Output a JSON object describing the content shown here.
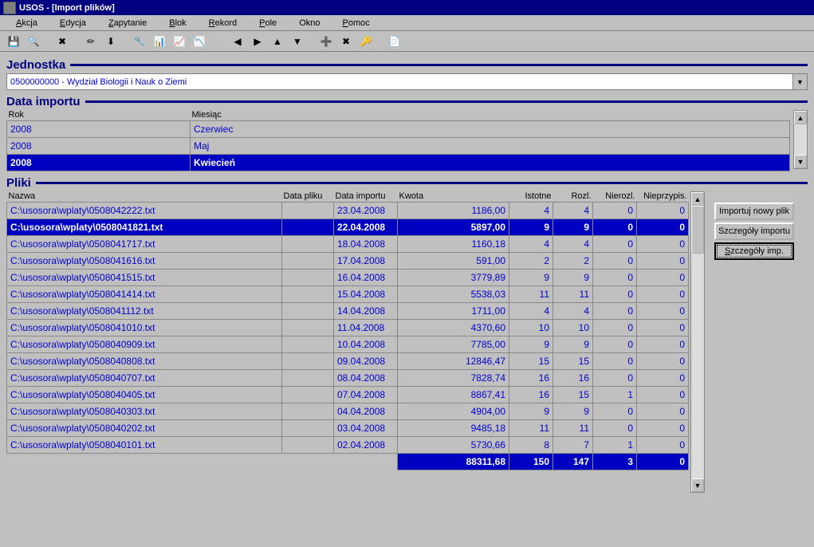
{
  "window": {
    "title": "USOS - [Import plików]"
  },
  "menu": {
    "items": [
      {
        "label": "Akcja",
        "u": 0
      },
      {
        "label": "Edycja",
        "u": 0
      },
      {
        "label": "Zapytanie",
        "u": 0
      },
      {
        "label": "Blok",
        "u": 0
      },
      {
        "label": "Rekord",
        "u": 0
      },
      {
        "label": "Pole",
        "u": 0
      },
      {
        "label": "Okno",
        "u": -1
      },
      {
        "label": "Pomoc",
        "u": 0
      }
    ]
  },
  "toolbar_icons": [
    "💾",
    "🔍",
    "✖",
    "✏",
    "⬇",
    "🔧",
    "📊",
    "📈",
    "📉",
    "◀",
    "▶",
    "▲",
    "▼",
    "➕",
    "✖",
    "🔑",
    "📄"
  ],
  "sections": {
    "jednostka": "Jednostka",
    "data_importu": "Data importu",
    "pliki": "Pliki"
  },
  "jednostka": {
    "value": "0500000000 - Wydział Biologii i Nauk o Ziemi"
  },
  "date_headers": {
    "rok": "Rok",
    "miesiac": "Miesiąc"
  },
  "dates": [
    {
      "rok": "2008",
      "miesiac": "Czerwiec",
      "sel": false
    },
    {
      "rok": "2008",
      "miesiac": "Maj",
      "sel": false
    },
    {
      "rok": "2008",
      "miesiac": "Kwiecień",
      "sel": true
    }
  ],
  "pliki_headers": {
    "nazwa": "Nazwa",
    "data_pliku": "Data pliku",
    "data_importu": "Data importu",
    "kwota": "Kwota",
    "istotne": "Istotne",
    "rozl": "Rozl.",
    "nierozl": "Nierozl.",
    "nieprzypis": "Nieprzypis."
  },
  "pliki": [
    {
      "nazwa": "C:\\usosora\\wplaty\\0508042222.txt",
      "dp": "",
      "di": "23.04.2008",
      "kw": "1186,00",
      "ist": "4",
      "roz": "4",
      "nr": "0",
      "np": "0",
      "sel": false
    },
    {
      "nazwa": "C:\\usosora\\wplaty\\0508041821.txt",
      "dp": "",
      "di": "22.04.2008",
      "kw": "5897,00",
      "ist": "9",
      "roz": "9",
      "nr": "0",
      "np": "0",
      "sel": true
    },
    {
      "nazwa": "C:\\usosora\\wplaty\\0508041717.txt",
      "dp": "",
      "di": "18.04.2008",
      "kw": "1160,18",
      "ist": "4",
      "roz": "4",
      "nr": "0",
      "np": "0",
      "sel": false
    },
    {
      "nazwa": "C:\\usosora\\wplaty\\0508041616.txt",
      "dp": "",
      "di": "17.04.2008",
      "kw": "591,00",
      "ist": "2",
      "roz": "2",
      "nr": "0",
      "np": "0",
      "sel": false
    },
    {
      "nazwa": "C:\\usosora\\wplaty\\0508041515.txt",
      "dp": "",
      "di": "16.04.2008",
      "kw": "3779,89",
      "ist": "9",
      "roz": "9",
      "nr": "0",
      "np": "0",
      "sel": false
    },
    {
      "nazwa": "C:\\usosora\\wplaty\\0508041414.txt",
      "dp": "",
      "di": "15.04.2008",
      "kw": "5538,03",
      "ist": "11",
      "roz": "11",
      "nr": "0",
      "np": "0",
      "sel": false
    },
    {
      "nazwa": "C:\\usosora\\wplaty\\0508041112.txt",
      "dp": "",
      "di": "14.04.2008",
      "kw": "1711,00",
      "ist": "4",
      "roz": "4",
      "nr": "0",
      "np": "0",
      "sel": false
    },
    {
      "nazwa": "C:\\usosora\\wplaty\\0508041010.txt",
      "dp": "",
      "di": "11.04.2008",
      "kw": "4370,60",
      "ist": "10",
      "roz": "10",
      "nr": "0",
      "np": "0",
      "sel": false
    },
    {
      "nazwa": "C:\\usosora\\wplaty\\0508040909.txt",
      "dp": "",
      "di": "10.04.2008",
      "kw": "7785,00",
      "ist": "9",
      "roz": "9",
      "nr": "0",
      "np": "0",
      "sel": false
    },
    {
      "nazwa": "C:\\usosora\\wplaty\\0508040808.txt",
      "dp": "",
      "di": "09.04.2008",
      "kw": "12846,47",
      "ist": "15",
      "roz": "15",
      "nr": "0",
      "np": "0",
      "sel": false
    },
    {
      "nazwa": "C:\\usosora\\wplaty\\0508040707.txt",
      "dp": "",
      "di": "08.04.2008",
      "kw": "7828,74",
      "ist": "16",
      "roz": "16",
      "nr": "0",
      "np": "0",
      "sel": false
    },
    {
      "nazwa": "C:\\usosora\\wplaty\\0508040405.txt",
      "dp": "",
      "di": "07.04.2008",
      "kw": "8867,41",
      "ist": "16",
      "roz": "15",
      "nr": "1",
      "np": "0",
      "sel": false
    },
    {
      "nazwa": "C:\\usosora\\wplaty\\0508040303.txt",
      "dp": "",
      "di": "04.04.2008",
      "kw": "4904,00",
      "ist": "9",
      "roz": "9",
      "nr": "0",
      "np": "0",
      "sel": false
    },
    {
      "nazwa": "C:\\usosora\\wplaty\\0508040202.txt",
      "dp": "",
      "di": "03.04.2008",
      "kw": "9485,18",
      "ist": "11",
      "roz": "11",
      "nr": "0",
      "np": "0",
      "sel": false
    },
    {
      "nazwa": "C:\\usosora\\wplaty\\0508040101.txt",
      "dp": "",
      "di": "02.04.2008",
      "kw": "5730,66",
      "ist": "8",
      "roz": "7",
      "nr": "1",
      "np": "0",
      "sel": false
    }
  ],
  "totals": {
    "kw": "88311,68",
    "ist": "150",
    "roz": "147",
    "nr": "3",
    "np": "0"
  },
  "buttons": {
    "import": "Importuj nowy plik",
    "details": "Szczegóły importu",
    "details2": "Szczegóły imp."
  },
  "col_widths": {
    "nazwa": 345,
    "dp": 65,
    "di": 80,
    "kw": 140,
    "ist": 55,
    "roz": 50,
    "nr": 55,
    "np": 65
  }
}
